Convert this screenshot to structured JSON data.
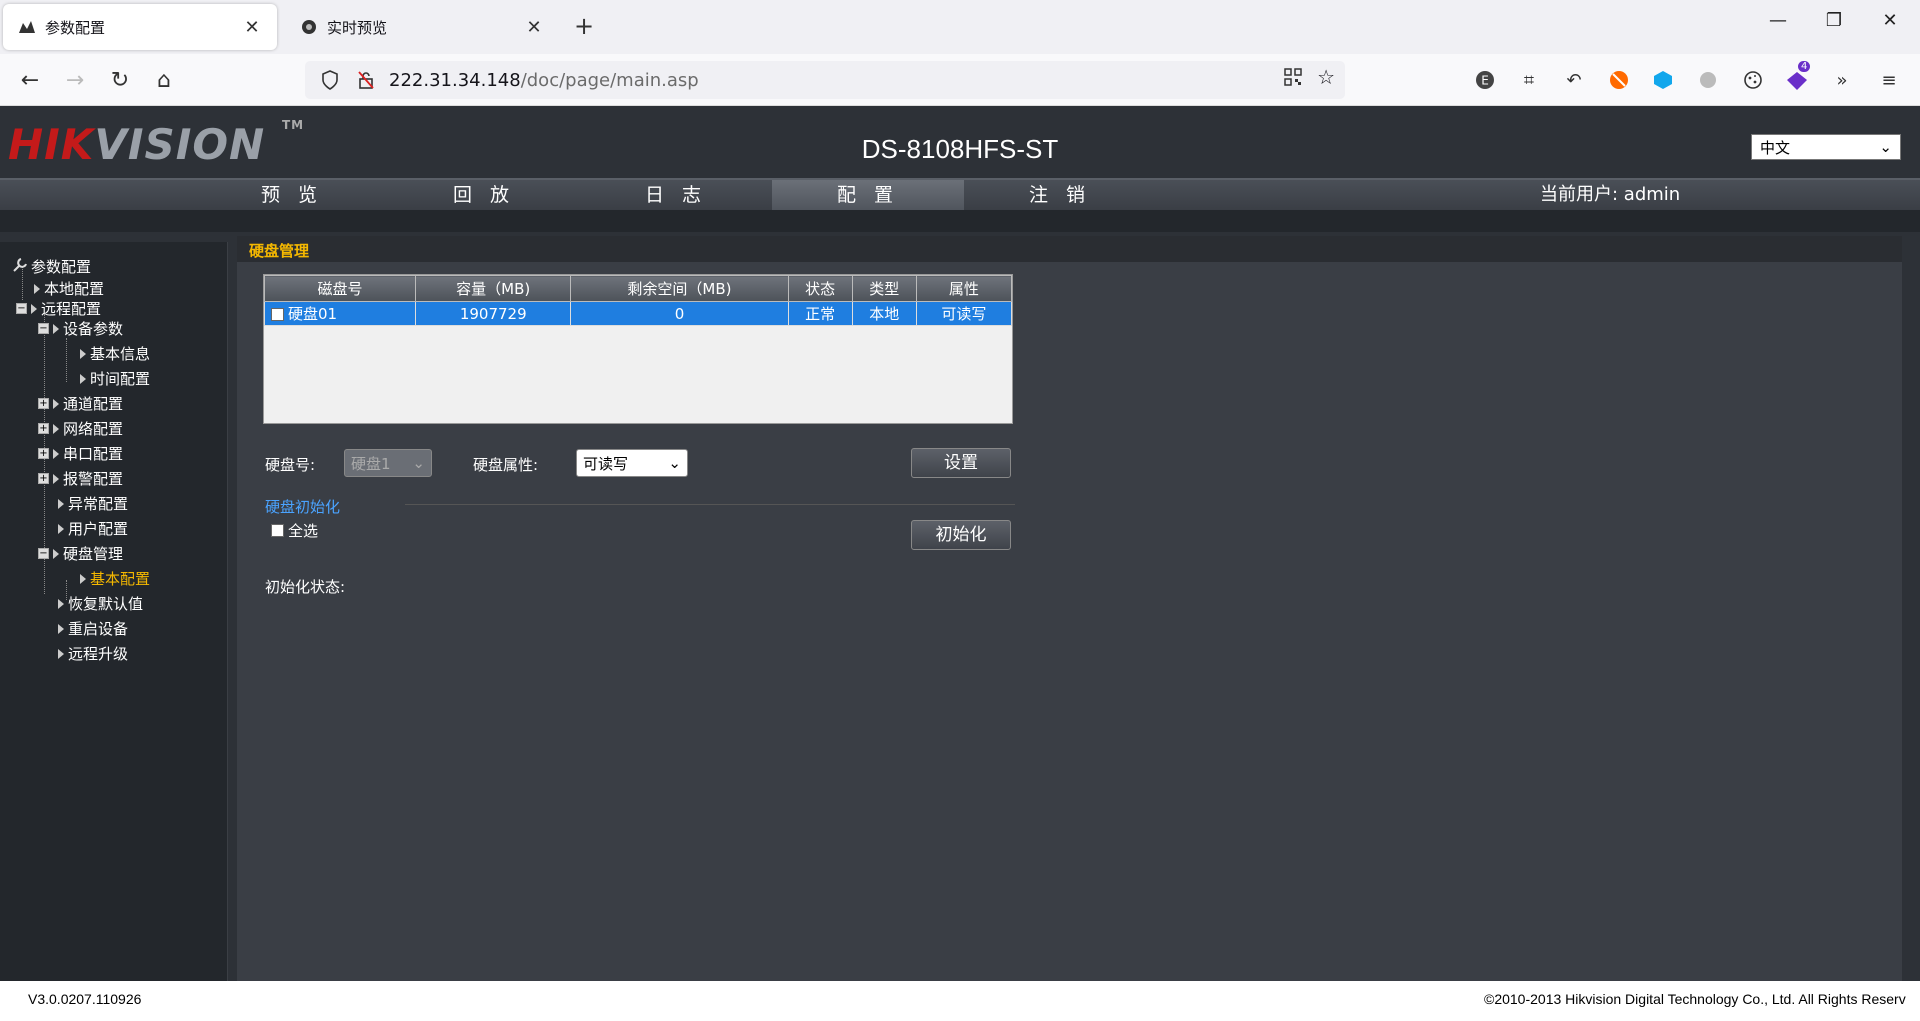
{
  "browser": {
    "tabs": [
      {
        "title": "参数配置",
        "active": true
      },
      {
        "title": "实时预览",
        "active": false
      }
    ],
    "url_host": "222.31.34.148",
    "url_path": "/doc/page/main.asp",
    "extension_badge": "4"
  },
  "header": {
    "logo_red": "HIK",
    "logo_gray": "VISION",
    "logo_tm": "TM",
    "device_model": "DS-8108HFS-ST",
    "language": "中文"
  },
  "menu": {
    "items": [
      "预 览",
      "回 放",
      "日 志",
      "配 置",
      "注 销"
    ],
    "active_index": 3,
    "current_user": "当前用户: admin"
  },
  "tree": {
    "root": "参数配置",
    "items": [
      "本地配置",
      "远程配置",
      "设备参数",
      "基本信息",
      "时间配置",
      "通道配置",
      "网络配置",
      "串口配置",
      "报警配置",
      "异常配置",
      "用户配置",
      "硬盘管理",
      "基本配置",
      "恢复默认值",
      "重启设备",
      "远程升级"
    ],
    "selected": "基本配置"
  },
  "content": {
    "title": "硬盘管理",
    "table": {
      "headers": [
        "磁盘号",
        "容量（MB)",
        "剩余空间（MB)",
        "状态",
        "类型",
        "属性"
      ],
      "rows": [
        [
          "硬盘01",
          "1907729",
          "0",
          "正常",
          "本地",
          "可读写"
        ]
      ]
    },
    "disk_no_label": "硬盘号:",
    "disk_no_value": "硬盘1",
    "disk_prop_label": "硬盘属性:",
    "disk_prop_value": "可读写",
    "set_button": "设置",
    "init_section": "硬盘初始化",
    "select_all": "全选",
    "init_button": "初始化",
    "init_status_label": "初始化状态:"
  },
  "footer": {
    "version": "V3.0.0207.110926",
    "copyright": "©2010-2013 Hikvision Digital Technology Co., Ltd. All Rights Reserv"
  }
}
